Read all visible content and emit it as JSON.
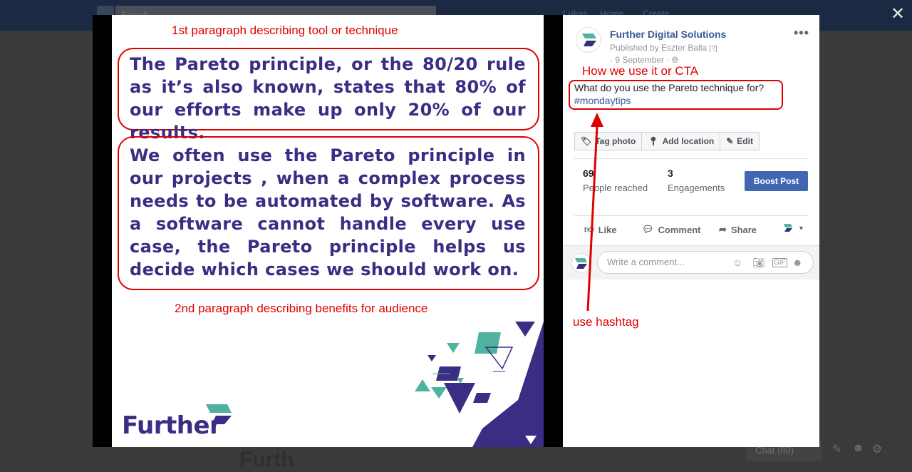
{
  "background": {
    "search_placeholder": "Search",
    "nav": [
      "Lukas",
      "Home",
      "Create"
    ],
    "chat_label": "Chat (80)",
    "further_text": "Furth"
  },
  "viewer": {
    "close_icon": "close-icon"
  },
  "image": {
    "annotation_top": "1st paragraph describing tool or technique",
    "paragraph1": "The Pareto principle, or the 80/20 rule as it’s also known, states that 80% of our efforts make up only 20% of our results.",
    "paragraph2": "We often use the Pareto principle in our projects , when a complex process needs to be automated by software. As a software cannot handle every use case, the Pareto principle helps us decide which cases we should work on.",
    "annotation_bottom": "2nd paragraph describing benefits for audience",
    "brand": "Further",
    "colors": {
      "text": "#3a2d84",
      "annotation": "#e00000",
      "teal": "#4fb3a0"
    }
  },
  "post": {
    "page_name": "Further Digital Solutions",
    "published_by": "Published by Eszter Balla",
    "published_by_help": "[?]",
    "date": "· 9 September ·",
    "annotation_cta": "How we use it or CTA",
    "text_line": "What do you use the Pareto technique for?",
    "hashtag": "#mondaytips",
    "tools": [
      {
        "label": "Tag photo",
        "icon": "tag-icon"
      },
      {
        "label": "Add location",
        "icon": "location-pin-icon"
      },
      {
        "label": "Edit",
        "icon": "pencil-icon"
      }
    ],
    "stats": {
      "reached_value": "69",
      "reached_label": "People reached",
      "engagements_value": "3",
      "engagements_label": "Engagements"
    },
    "boost_label": "Boost Post",
    "actions": {
      "like": "Like",
      "comment": "Comment",
      "share": "Share"
    },
    "comment_placeholder": "Write a comment...",
    "annotation_hashtag": "use hashtag",
    "colors": {
      "link": "#385898",
      "boost": "#4267b2"
    }
  }
}
